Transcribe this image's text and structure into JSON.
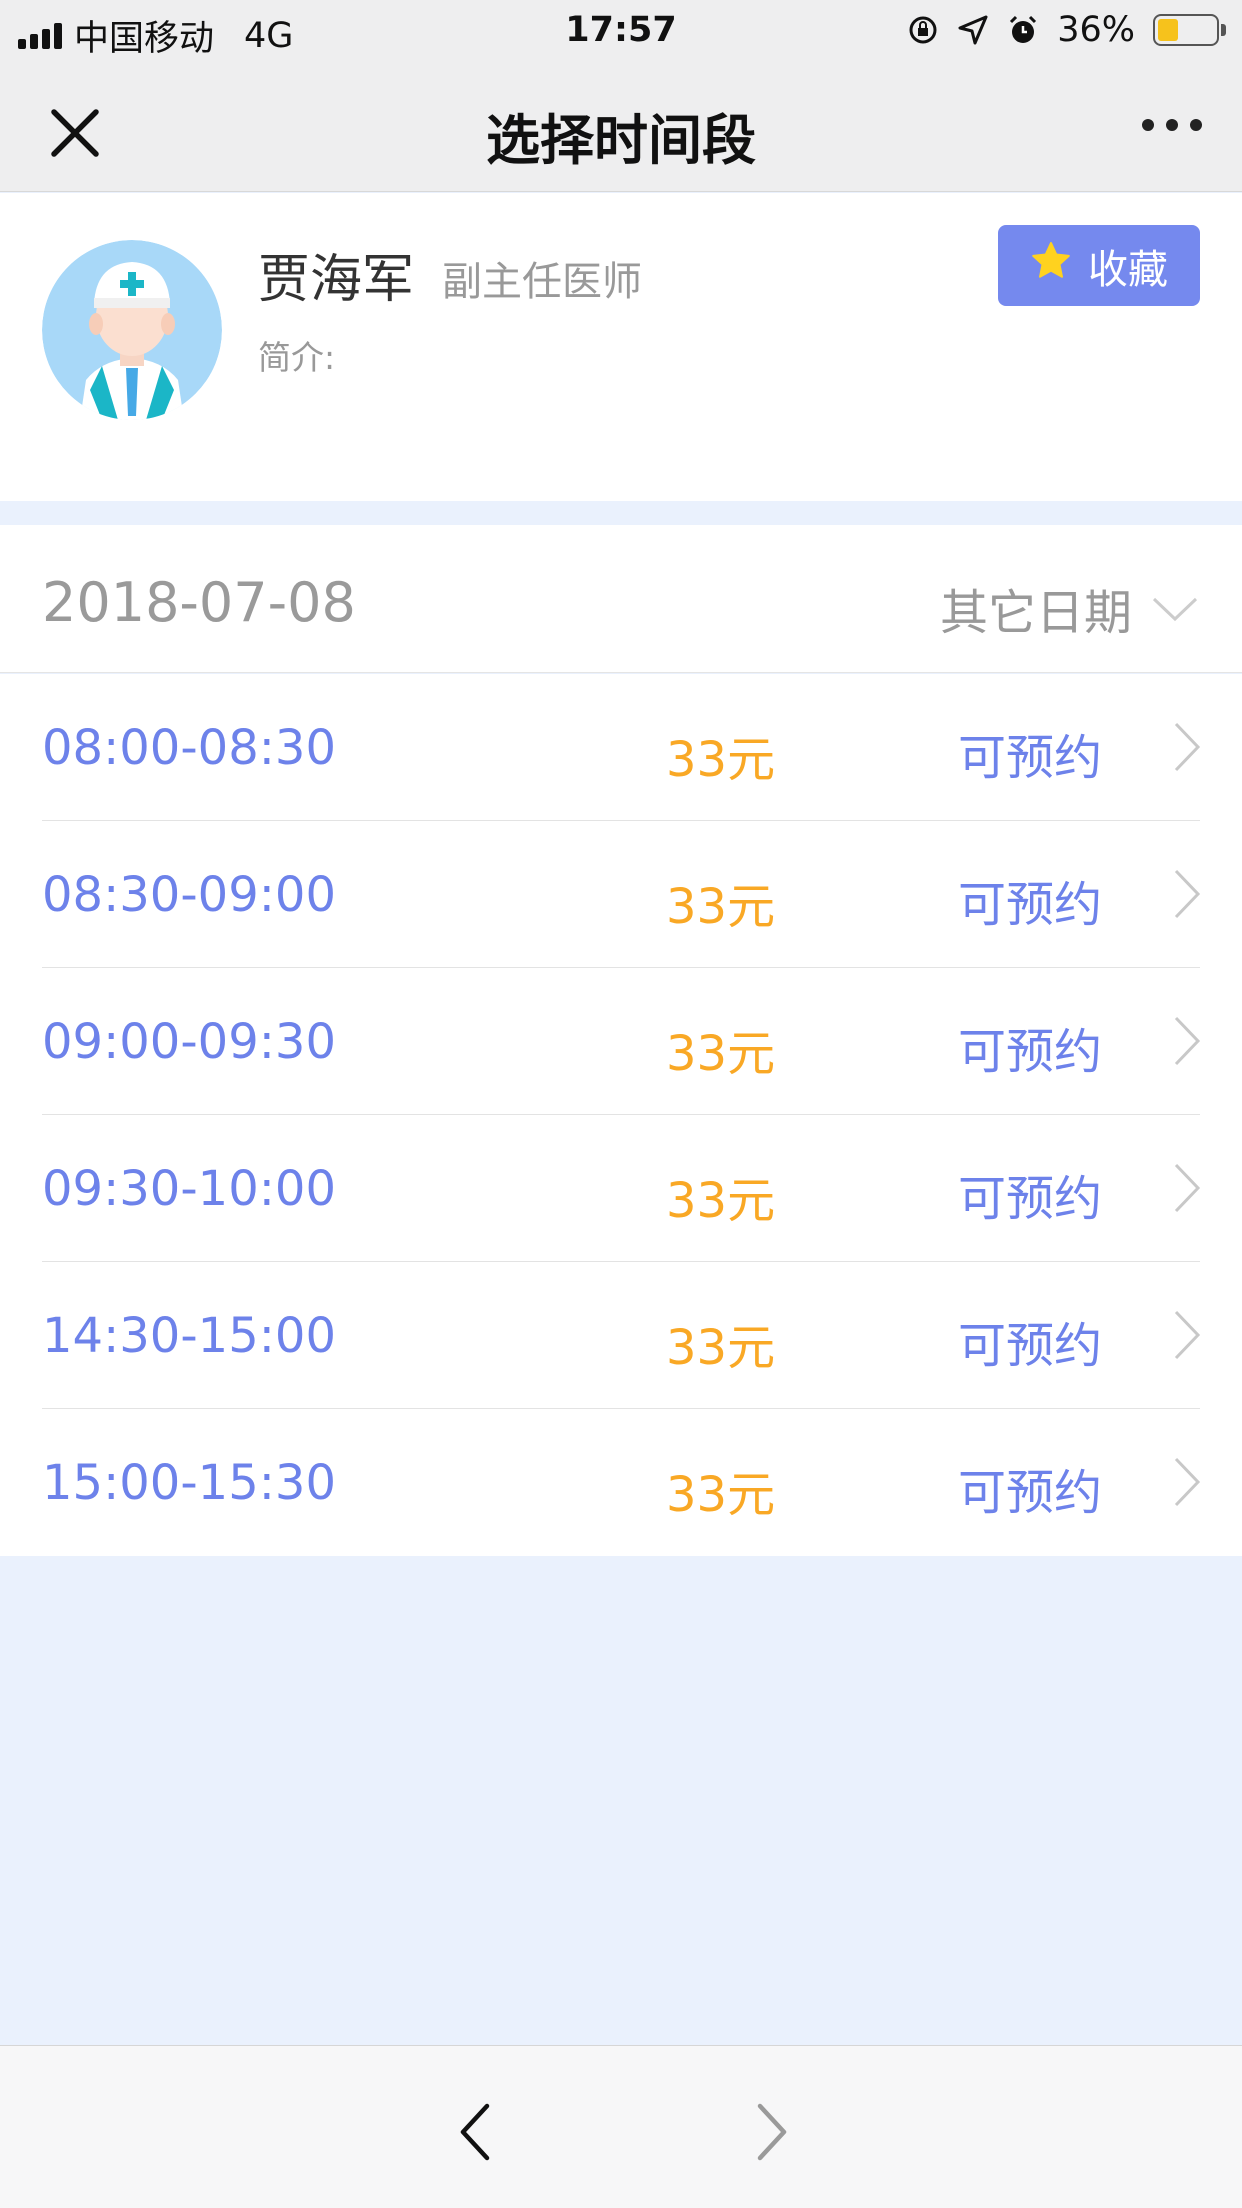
{
  "status_bar": {
    "carrier": "中国移动",
    "network": "4G",
    "time": "17:57",
    "battery_percent": "36%",
    "battery_level": 0.36
  },
  "nav": {
    "title": "选择时间段",
    "close_icon": "close-icon",
    "more_icon": "more-icon"
  },
  "doctor": {
    "name": "贾海军",
    "title": "副主任医师",
    "intro_label": "简介:",
    "favorite_label": "收藏",
    "favorite_icon": "star-icon"
  },
  "date": {
    "selected": "2018-07-08",
    "other_label": "其它日期"
  },
  "slots": [
    {
      "time": "08:00-08:30",
      "price": "33元",
      "status": "可预约"
    },
    {
      "time": "08:30-09:00",
      "price": "33元",
      "status": "可预约"
    },
    {
      "time": "09:00-09:30",
      "price": "33元",
      "status": "可预约"
    },
    {
      "time": "09:30-10:00",
      "price": "33元",
      "status": "可预约"
    },
    {
      "time": "14:30-15:00",
      "price": "33元",
      "status": "可预约"
    },
    {
      "time": "15:00-15:30",
      "price": "33元",
      "status": "可预约"
    }
  ],
  "colors": {
    "accent": "#6d82ea",
    "price": "#f9a825",
    "favorite_bg": "#7589ee",
    "page_bg": "#eaf1fd"
  }
}
